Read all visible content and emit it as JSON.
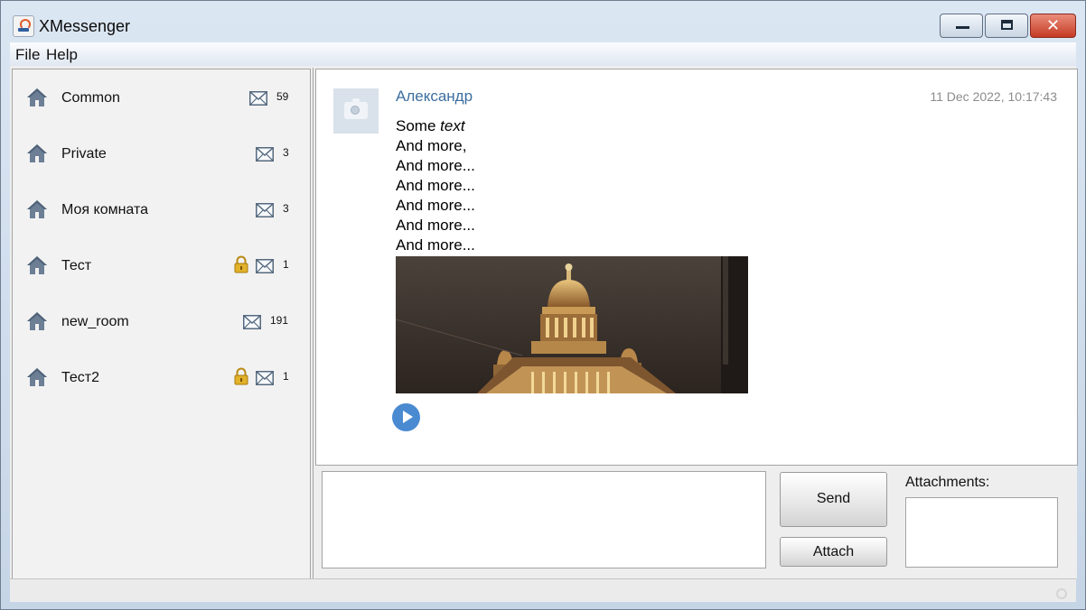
{
  "window": {
    "title": "XMessenger",
    "app_icon": "java-cup-icon",
    "controls": [
      "minimize-icon",
      "maximize-icon",
      "close-icon"
    ],
    "close_glyph": "✕"
  },
  "menu": {
    "items": [
      {
        "label": "File"
      },
      {
        "label": "Help"
      }
    ]
  },
  "rooms": [
    {
      "name": "Common",
      "count": "59",
      "locked": false,
      "icon": "house-icon"
    },
    {
      "name": "Private",
      "count": "3",
      "locked": false,
      "icon": "house-icon"
    },
    {
      "name": "Моя комната",
      "count": "3",
      "locked": false,
      "icon": "house-icon"
    },
    {
      "name": "Тест",
      "count": "1",
      "locked": true,
      "icon": "house-icon"
    },
    {
      "name": "new_room",
      "count": "191",
      "locked": false,
      "icon": "house-icon"
    },
    {
      "name": "Тест2",
      "count": "1",
      "locked": true,
      "icon": "house-icon"
    }
  ],
  "message": {
    "sender": "Александр",
    "timestamp": "11 Dec 2022, 10:17:43",
    "avatar_icon": "camera-icon",
    "first_line_plain": "Some ",
    "first_line_italic": "text",
    "lines": [
      "And more,",
      "And more...",
      "And more...",
      "And more...",
      "And more...",
      "And more..."
    ],
    "attachment_image": "cathedral-at-night-photo",
    "audio_icon": "play-icon"
  },
  "composer": {
    "send_label": "Send",
    "attach_label": "Attach",
    "attachments_label": "Attachments:"
  },
  "colors": {
    "sender": "#3c6e9f",
    "accent_play": "#4a8ad1",
    "lock": "#d4a20f"
  }
}
